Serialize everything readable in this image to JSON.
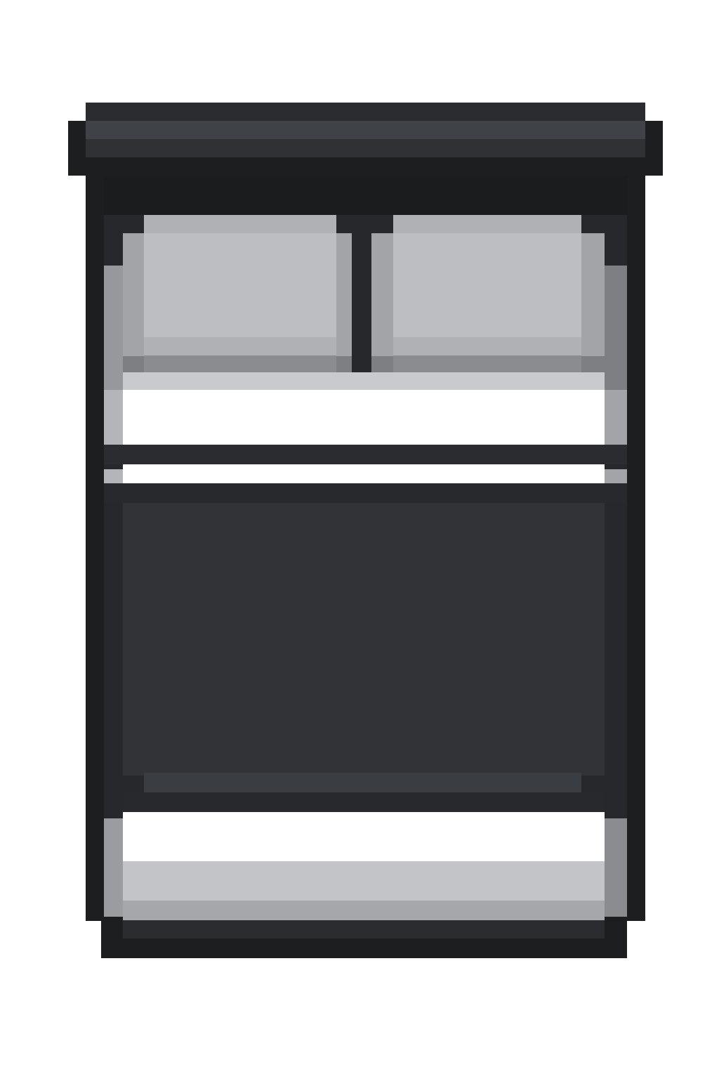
{
  "scene": {
    "subject": "bed-sprite",
    "style": "pixel-art",
    "view": "top-down"
  },
  "colors": {
    "background": "#ffffff",
    "frame_dark": "#1d1e20",
    "frame_mid": "#2a2c2f",
    "frame_highlight": "#3f4246",
    "pillow_light": "#bdbec1",
    "pillow_mid": "#a3a4a8",
    "pillow_shadow": "#7e7f83",
    "sheet_white": "#ffffff",
    "sheet_grey": "#c9cacd",
    "sheet_shadow": "#97989c",
    "blanket": "#313337",
    "blanket_edge": "#3a3d41",
    "blanket_shadow": "#27292c"
  },
  "icons": [
    "bed-headboard-icon",
    "pillow-icon",
    "blanket-icon",
    "footboard-icon"
  ]
}
